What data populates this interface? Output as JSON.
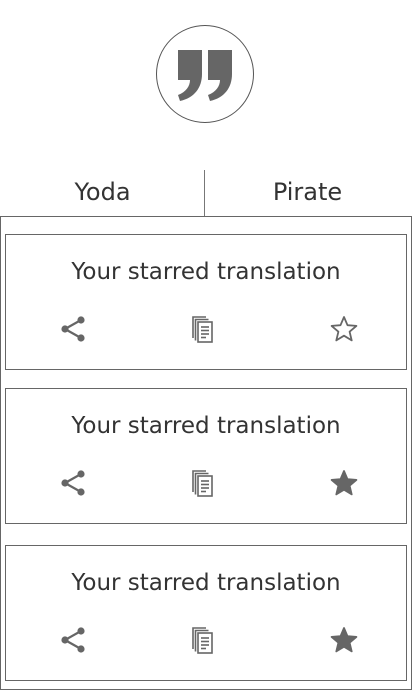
{
  "logo": {
    "icon": "quote-icon"
  },
  "tabs": [
    {
      "label": "Yoda"
    },
    {
      "label": "Pirate"
    }
  ],
  "cards": [
    {
      "text": "Your starred translation",
      "starred": false
    },
    {
      "text": "Your starred translation",
      "starred": true
    },
    {
      "text": "Your starred translation",
      "starred": true
    }
  ],
  "icons": {
    "share": "share-icon",
    "copy": "copy-icon",
    "star": "star-icon"
  },
  "colors": {
    "icon": "#666666",
    "border": "#666666",
    "text": "#333333"
  }
}
